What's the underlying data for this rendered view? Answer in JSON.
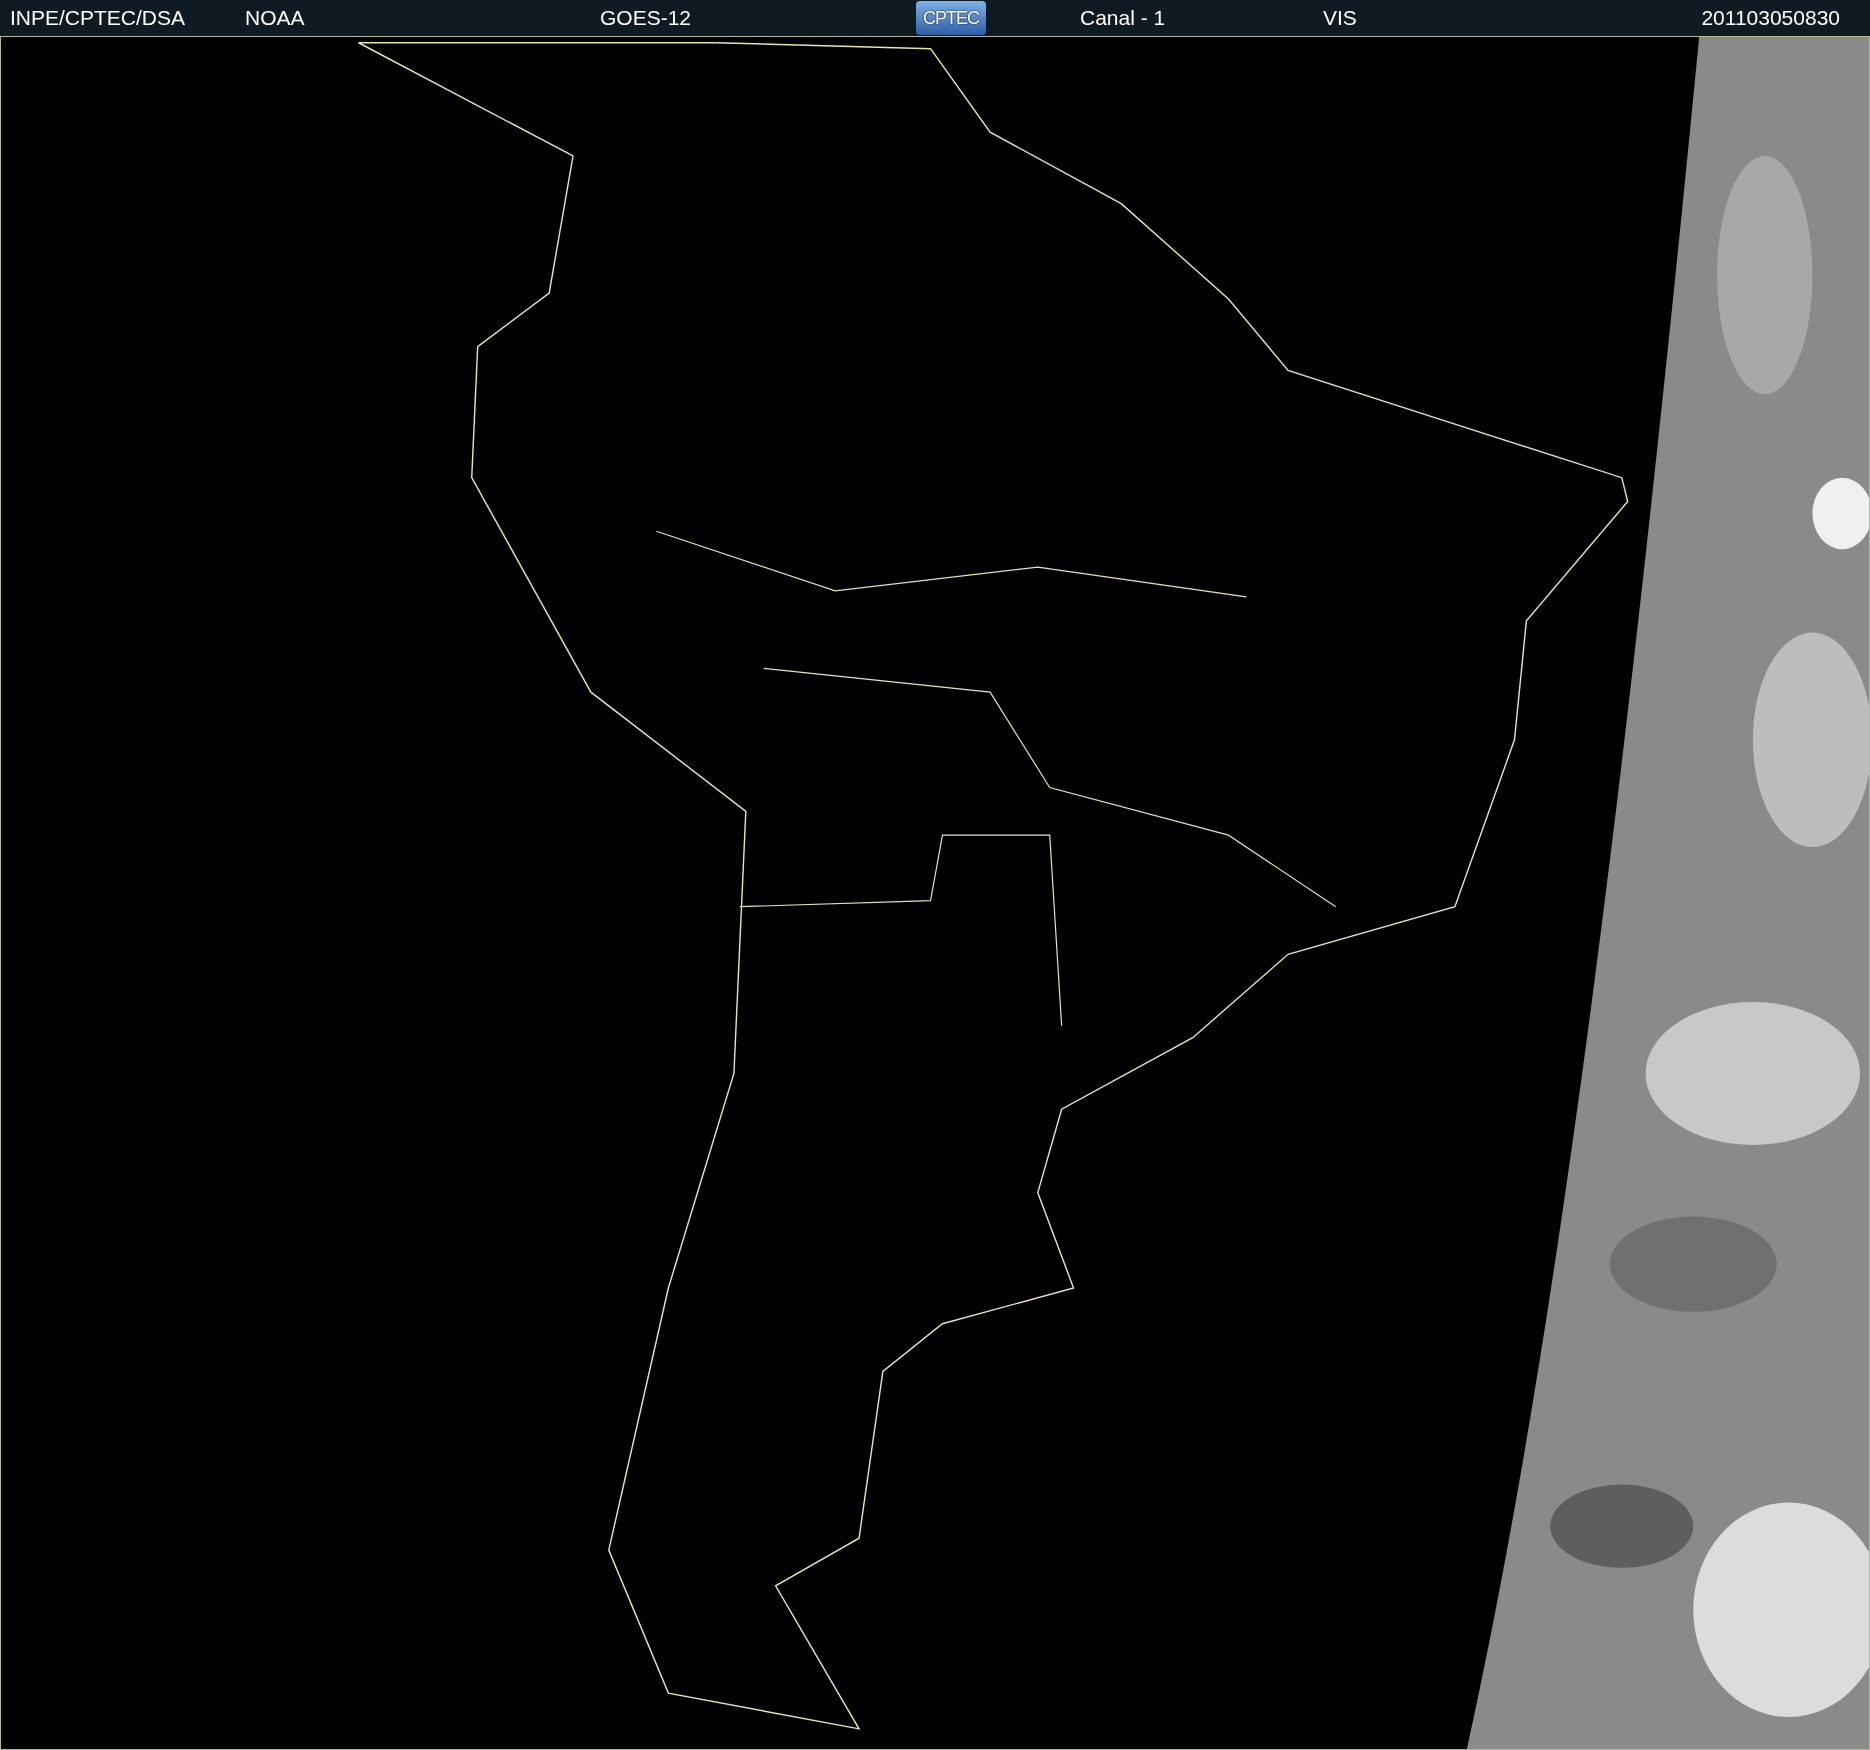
{
  "header": {
    "items": [
      {
        "kind": "text",
        "text": "INPE/CPTEC/DSA"
      },
      {
        "kind": "text",
        "text": "NOAA"
      },
      {
        "kind": "text",
        "text": "GOES-12"
      },
      {
        "kind": "logo",
        "text": "CPTEC"
      },
      {
        "kind": "text",
        "text": "Canal - 1"
      },
      {
        "kind": "text",
        "text": "VIS"
      },
      {
        "kind": "text",
        "text": "201103050830"
      }
    ]
  }
}
